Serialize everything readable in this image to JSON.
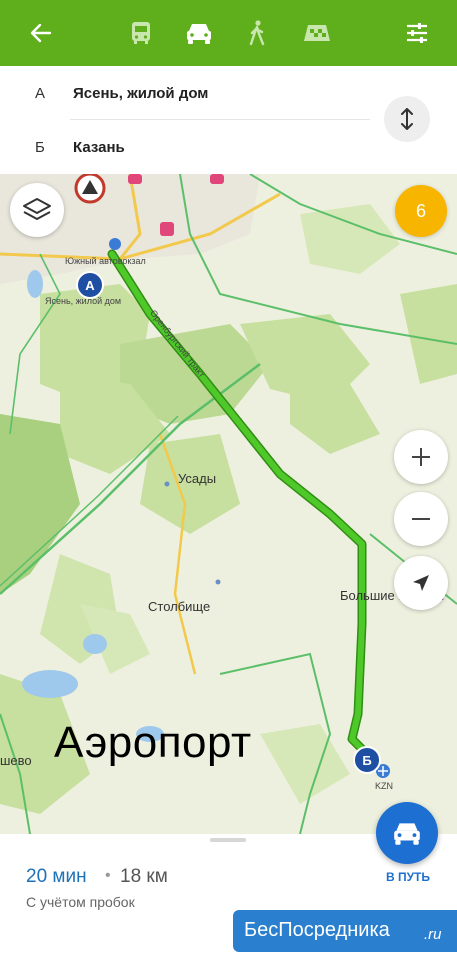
{
  "topbar": {
    "background": "#5fae1c",
    "back_icon": "arrow-left-icon",
    "modes": [
      {
        "name": "bus-icon",
        "active": false
      },
      {
        "name": "car-icon",
        "active": true
      },
      {
        "name": "walk-icon",
        "active": false
      },
      {
        "name": "taxi-icon",
        "active": false
      }
    ],
    "settings_icon": "sliders-icon"
  },
  "route": {
    "from_letter": "А",
    "from_place": "Ясень, жилой дом",
    "to_letter": "Б",
    "to_place": "Казань",
    "swap_icon": "swap-vertical-icon"
  },
  "map": {
    "traffic_level": "6",
    "traffic_color": "#f7b500",
    "route_color": "#3fb21c",
    "labels": {
      "bus_station": "Южный автовокзал",
      "start_label": "Ясень, жилой дом",
      "road": "Оренбургский тракт",
      "village1": "Усады",
      "village2": "Столбище",
      "village3": "Большие Кабаны",
      "village4": "шево",
      "airport_code": "KZN"
    },
    "marker_a": "А",
    "marker_b": "Б",
    "caption": "Аэропорт",
    "zoom_in_icon": "plus-icon",
    "zoom_out_icon": "minus-icon",
    "locate_icon": "navigation-arrow-icon",
    "layers_icon": "layers-icon"
  },
  "summary": {
    "time": "20 мин",
    "separator": "•",
    "distance": "18 км",
    "note": "С учётом пробок"
  },
  "go": {
    "label": "В ПУТЬ",
    "icon": "car-front-icon",
    "color": "#1d6fd1"
  },
  "promo": {
    "text": "БесПосредника",
    "suffix": ".ru"
  }
}
